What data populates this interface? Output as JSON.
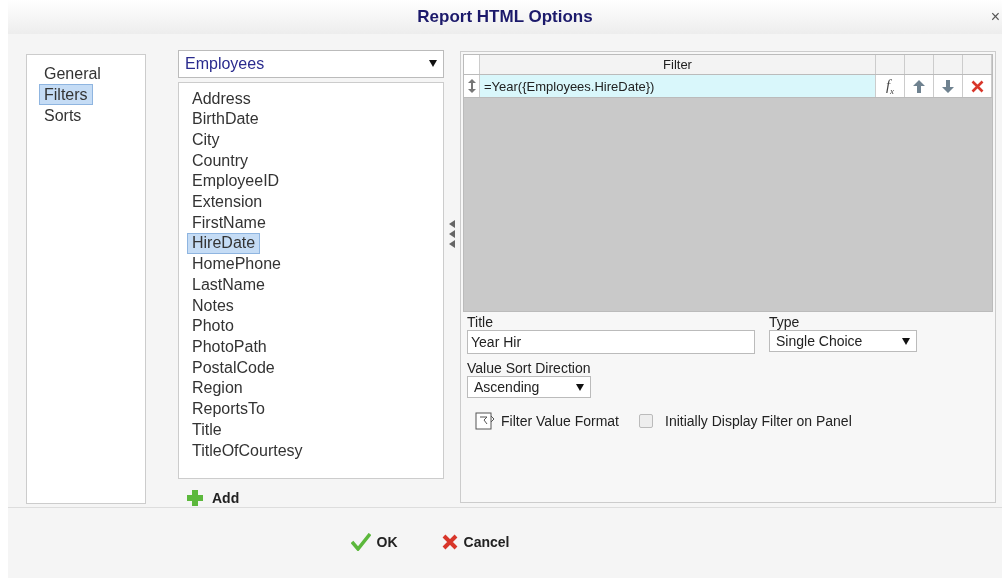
{
  "window": {
    "title": "Report HTML Options",
    "close": "×"
  },
  "nav": [
    {
      "label": "General",
      "selected": false
    },
    {
      "label": "Filters",
      "selected": true
    },
    {
      "label": "Sorts",
      "selected": false
    }
  ],
  "source": {
    "value": "Employees"
  },
  "fields": [
    {
      "label": "Address",
      "selected": false
    },
    {
      "label": "BirthDate",
      "selected": false
    },
    {
      "label": "City",
      "selected": false
    },
    {
      "label": "Country",
      "selected": false
    },
    {
      "label": "EmployeeID",
      "selected": false
    },
    {
      "label": "Extension",
      "selected": false
    },
    {
      "label": "FirstName",
      "selected": false
    },
    {
      "label": "HireDate",
      "selected": true
    },
    {
      "label": "HomePhone",
      "selected": false
    },
    {
      "label": "LastName",
      "selected": false
    },
    {
      "label": "Notes",
      "selected": false
    },
    {
      "label": "Photo",
      "selected": false
    },
    {
      "label": "PhotoPath",
      "selected": false
    },
    {
      "label": "PostalCode",
      "selected": false
    },
    {
      "label": "Region",
      "selected": false
    },
    {
      "label": "ReportsTo",
      "selected": false
    },
    {
      "label": "Title",
      "selected": false
    },
    {
      "label": "TitleOfCourtesy",
      "selected": false
    }
  ],
  "add_button": "Add",
  "filter_grid": {
    "formula_button": "f$_{x}$",
    "columns": [
      "Filter"
    ],
    "rows": [
      {
        "expression": "=Year({Employees.HireDate})",
        "selected": true
      }
    ]
  },
  "form": {
    "title_label": "Title",
    "title_value": "Year Hir",
    "type_label": "Type",
    "type_value": "Single Choice",
    "sort_label": "Value Sort Direction",
    "sort_value": "Ascending",
    "format_link": "Filter Value Format",
    "initial_display": {
      "label": "Initially Display Filter on Panel",
      "checked": false
    }
  },
  "buttons": [
    {
      "label": "OK",
      "kind": "ok"
    },
    {
      "label": "Cancel",
      "kind": "cancel"
    }
  ]
}
